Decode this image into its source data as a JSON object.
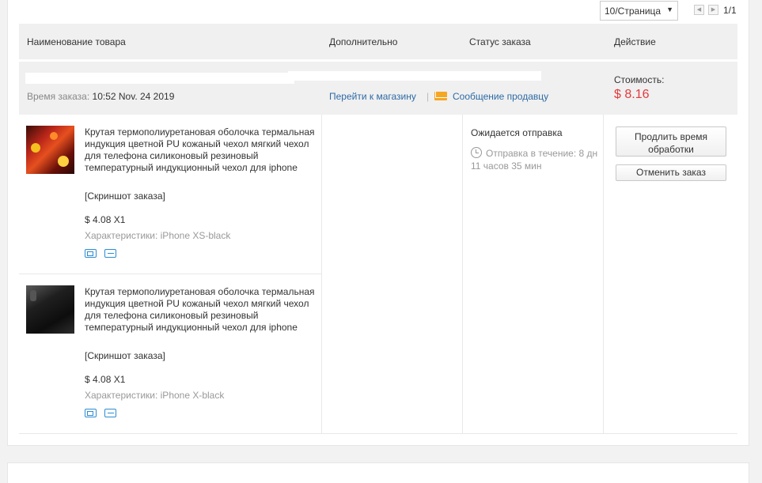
{
  "pager": {
    "per_page": "10/Страница",
    "page_count": "1/1"
  },
  "table_header": {
    "name": "Наименование товара",
    "extra": "Дополнительно",
    "status": "Статус заказа",
    "action": "Действие"
  },
  "order": {
    "time_label": "Время заказа:",
    "time_value": "10:52 Nov. 24 2019",
    "store_link": "Перейти к магазину",
    "separator": "|",
    "message_link": "Сообщение продавцу",
    "cost_label": "Стоимость:",
    "cost_value": "$ 8.16",
    "status": "Ожидается отправка",
    "ship_time": "Отправка в течение: 8 дн 11 часов 35 мин",
    "extend_button": "Продлить время обработки",
    "cancel_button": "Отменить заказ"
  },
  "products": [
    {
      "title": "Крутая термополиуретановая оболочка термальная индукция цветной PU кожаный чехол мягкий чехол для телефона силиконовый резиновый температурный индукционный чехол для iphone",
      "screenshot": "[Скриншот заказа]",
      "price": "$ 4.08 X1",
      "attributes": "Характеристики: iPhone XS-black",
      "icons": [
        "truck-icon",
        "return-icon"
      ]
    },
    {
      "title": "Крутая термополиуретановая оболочка термальная индукция цветной PU кожаный чехол мягкий чехол для телефона силиконовый резиновый температурный индукционный чехол для iphone",
      "screenshot": "[Скриншот заказа]",
      "price": "$ 4.08 X1",
      "attributes": "Характеристики: iPhone X-black",
      "icons": [
        "truck-icon",
        "return-icon"
      ]
    }
  ],
  "colors": {
    "link": "#2d6aa5",
    "price": "#e4393c",
    "header_bg": "#f0f0f0",
    "icon_blue": "#2d8cd0"
  }
}
